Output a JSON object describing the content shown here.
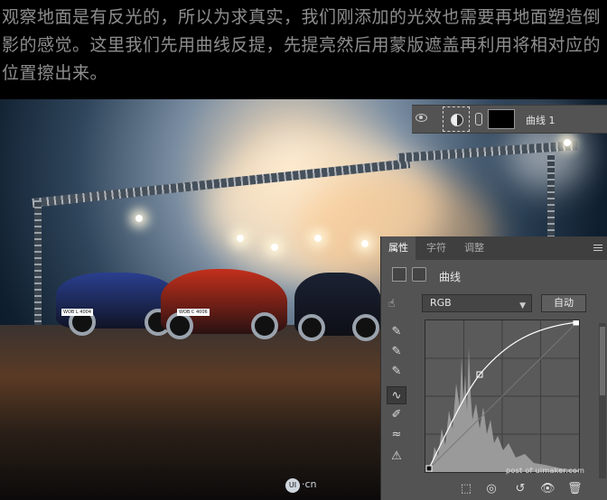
{
  "intro_text": "观察地面是有反光的，所以为求真实，我们刚添加的光效也需要再地面塑造倒影的感觉。这里我们先用曲线反提，先提亮然后用蒙版遮盖再利用将相对应的位置擦出来。",
  "layers": {
    "layer_name": "曲线 1"
  },
  "properties": {
    "tabs": [
      "属性",
      "字符",
      "调整"
    ],
    "header_title": "曲线",
    "channel": "RGB",
    "auto_label": "自动"
  },
  "cars": [
    {
      "plate": "WOB L 4004",
      "color": "#2a3f8f"
    },
    {
      "plate": "WOB C 4006",
      "color": "#c3301c"
    },
    {
      "plate": "",
      "color": "#1b2233"
    }
  ],
  "watermarks": {
    "logo": "UI",
    "logo_suffix": "·cn",
    "site": "post of uimaker.com"
  }
}
